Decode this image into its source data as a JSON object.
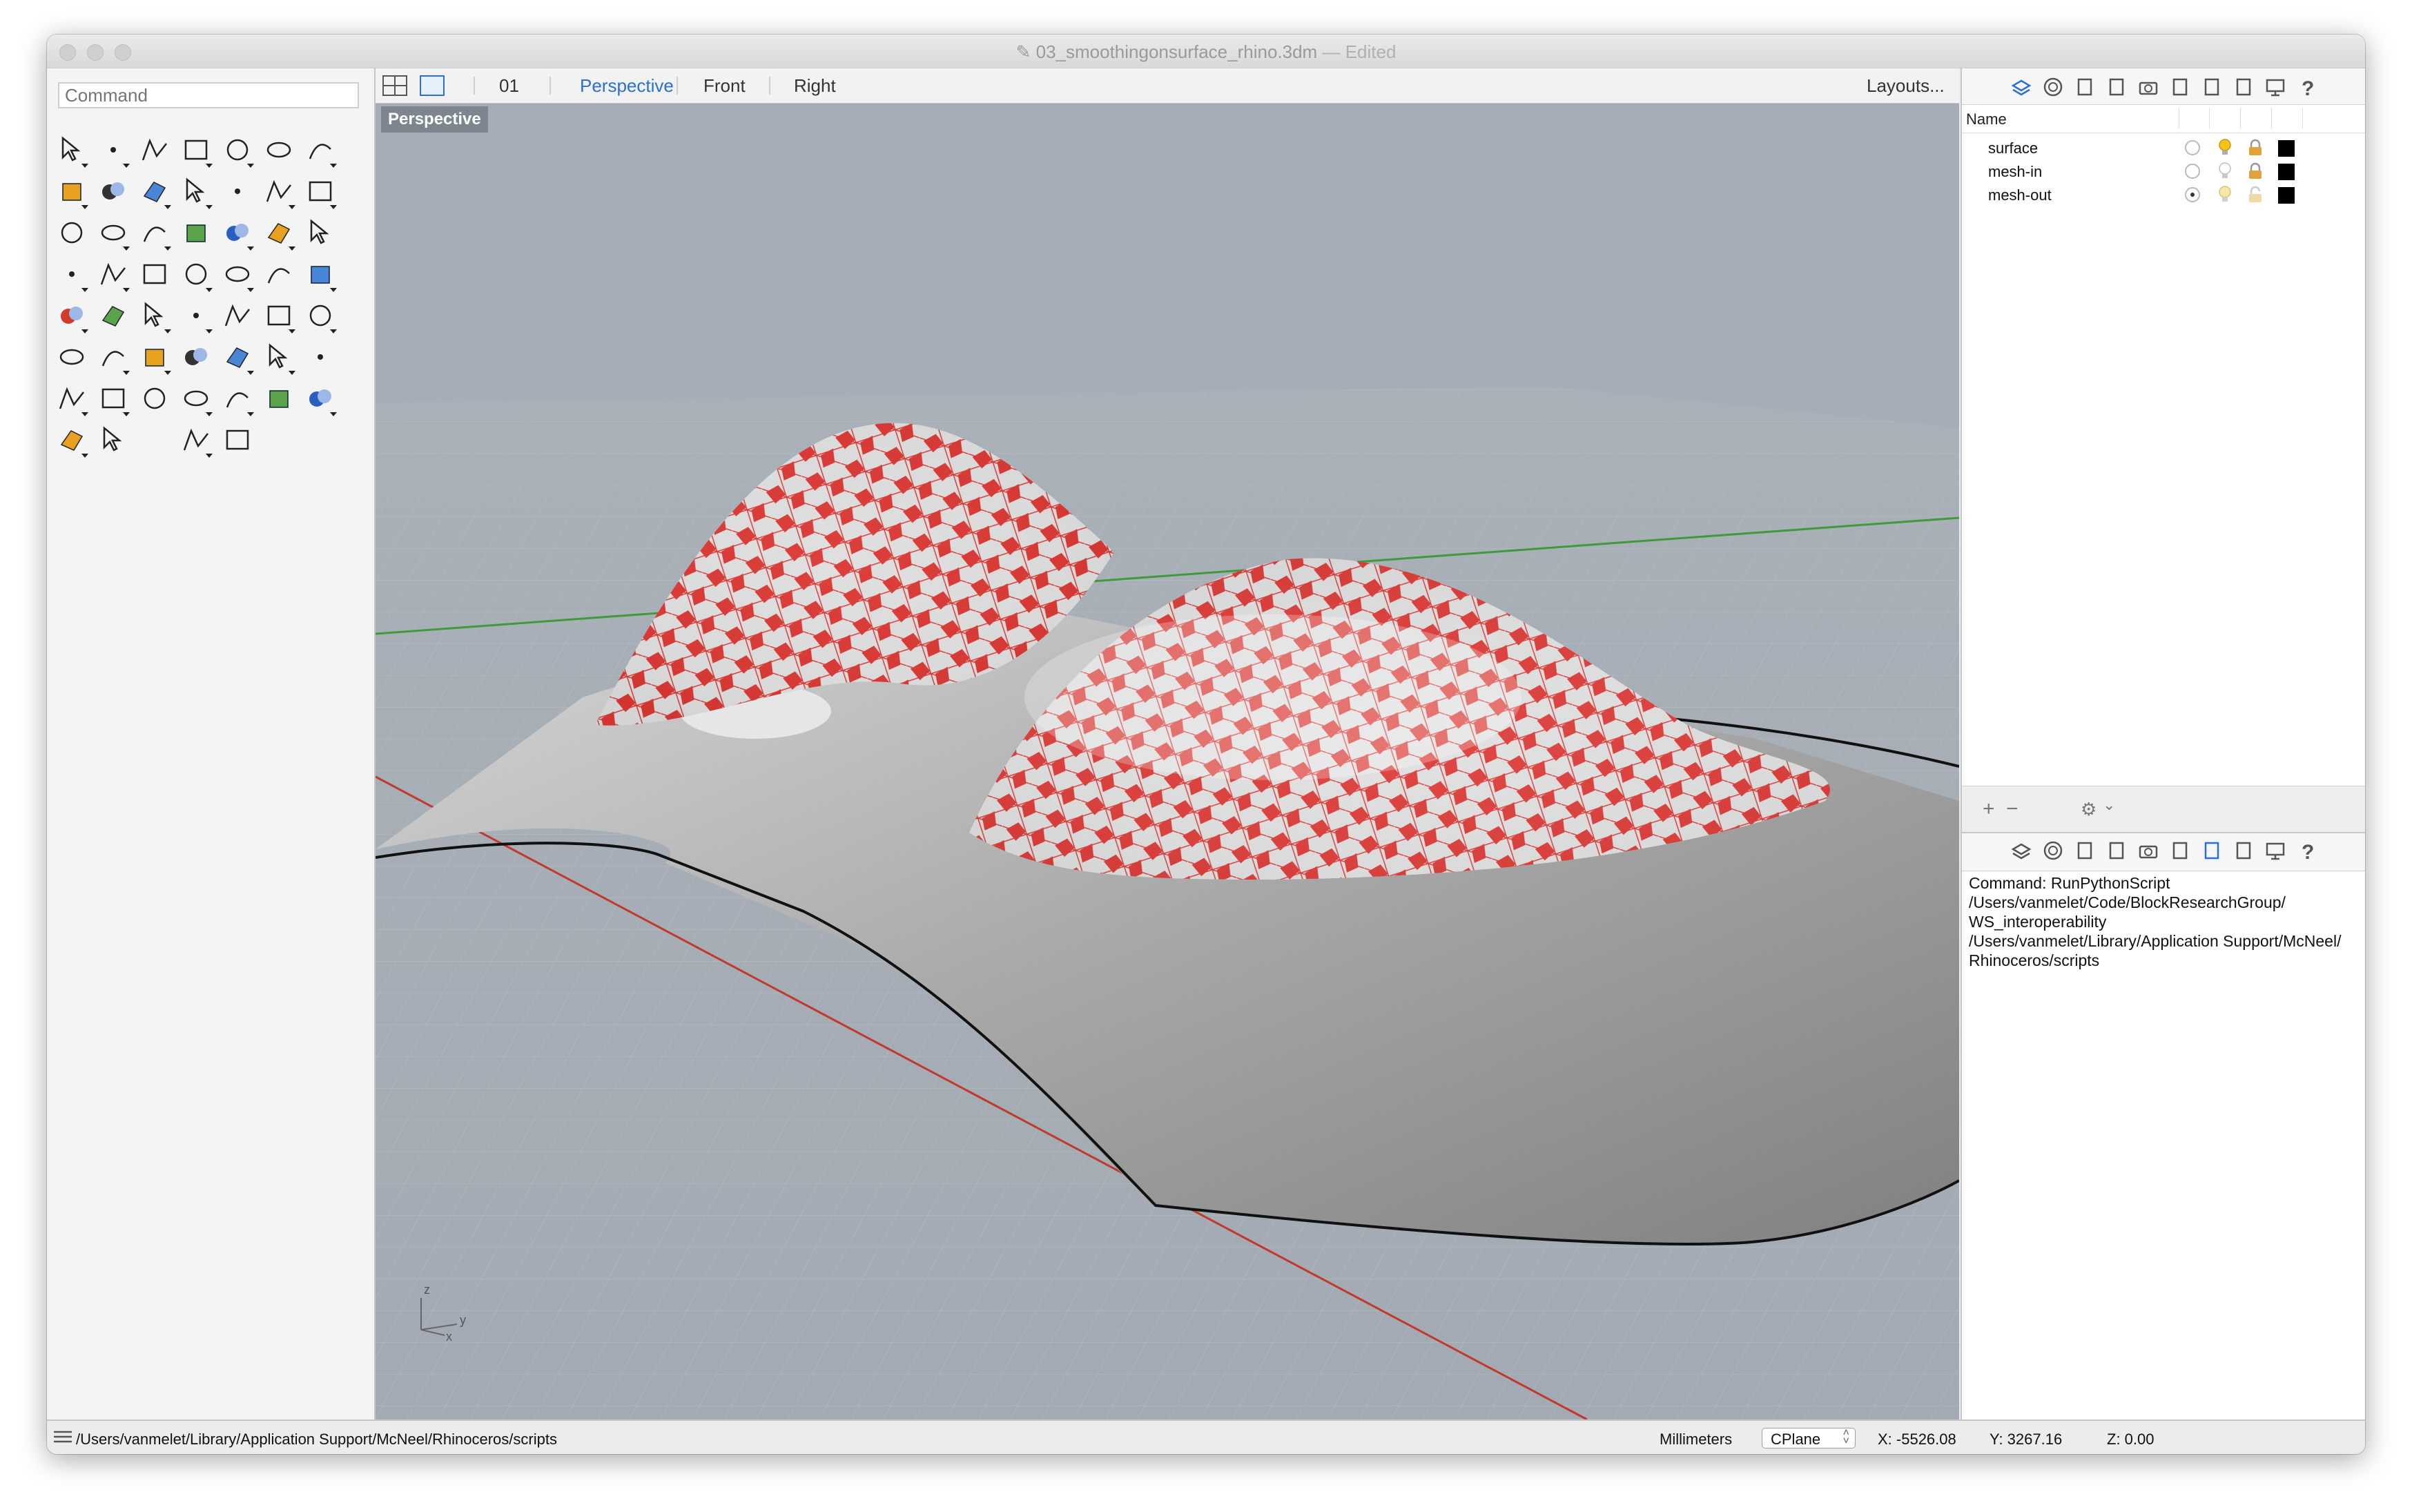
{
  "window": {
    "title": "03_smoothingonsurface_rhino.3dm",
    "title_separator": "—",
    "edited": "Edited"
  },
  "command": {
    "placeholder": "Command"
  },
  "toolbox": {
    "tools": [
      "select-arrow-icon",
      "point-icon",
      "polyline-icon",
      "curve-icon",
      "circle-icon",
      "ellipse-icon",
      "arc-icon",
      "rectangle-icon",
      "polygon-icon",
      "fillet-icon",
      "surface-from-points-icon",
      "extrude-surface-icon",
      "box-solid-icon",
      "boolean-union-icon",
      "cylinder-icon",
      "surface-patch-icon",
      "explode-icon",
      "extend-icon",
      "trim-icon",
      "split-icon",
      "boolean-difference-icon",
      "point-cloud-icon",
      "curve-offset-icon",
      "rebuild-icon",
      "text-icon",
      "scale-icon",
      "array-icon",
      "mirror-icon",
      "render-box-icon",
      "grid-snap-icon",
      "array-grid-icon",
      "align-icon",
      "analyze-icon",
      "check-icon",
      "boolean-icon",
      "paint-bucket-icon",
      "zoom-icon",
      "zoom-selected-icon",
      "zoom-extents-icon",
      "zoom-window-icon",
      "rotate-view-icon",
      "car-icon",
      "layout-grid-icon",
      "cplane-icon",
      "light-bulb-icon",
      "lock-icon",
      "material-icon",
      "color-wheel-icon",
      "sphere-wire-icon",
      "globe-icon",
      "render-sphere-icon",
      "",
      "pen-dim-icon",
      "dimension-icon",
      "",
      ""
    ]
  },
  "viewport_tabs": {
    "layout_icons": [
      "four-viewports-icon",
      "single-viewport-icon"
    ],
    "tabs": [
      "01",
      "Perspective",
      "Front",
      "Right"
    ],
    "active": "Perspective",
    "layouts_button": "Layouts..."
  },
  "viewport": {
    "label": "Perspective",
    "axis_z": "z",
    "axis_y": "y",
    "axis_x": "x",
    "background": "#a6adb6",
    "x_axis_color": "#c0392b",
    "y_axis_color": "#3f9a3a",
    "mesh_color": "#d8201b"
  },
  "panel_icons": [
    "layers-icon",
    "properties-icon",
    "document-icon",
    "object-box-icon",
    "camera-icon",
    "lights-icon",
    "notes-icon",
    "display-icon",
    "monitor-icon",
    "help-icon"
  ],
  "layers": {
    "column_header": "Name",
    "rows": [
      {
        "name": "surface",
        "current": false,
        "light_on": true,
        "locked": true,
        "color": "#000000"
      },
      {
        "name": "mesh-in",
        "current": false,
        "light_on": false,
        "locked": true,
        "color": "#000000"
      },
      {
        "name": "mesh-out",
        "current": true,
        "light_on": false,
        "locked": false,
        "color": "#000000"
      }
    ],
    "footer": {
      "add": "+",
      "remove": "−",
      "gear": "⚙",
      "gear_dropdown": "⌄"
    }
  },
  "history": {
    "lines": [
      "Command: RunPythonScript",
      "/Users/vanmelet/Code/BlockResearchGroup/",
      "WS_interoperability",
      "/Users/vanmelet/Library/Application Support/McNeel/",
      "Rhinoceros/scripts"
    ]
  },
  "status": {
    "path": "/Users/vanmelet/Library/Application Support/McNeel/Rhinoceros/scripts",
    "units": "Millimeters",
    "cplane": "CPlane",
    "x": "X: -5526.08",
    "y": "Y: 3267.16",
    "z": "Z: 0.00"
  }
}
